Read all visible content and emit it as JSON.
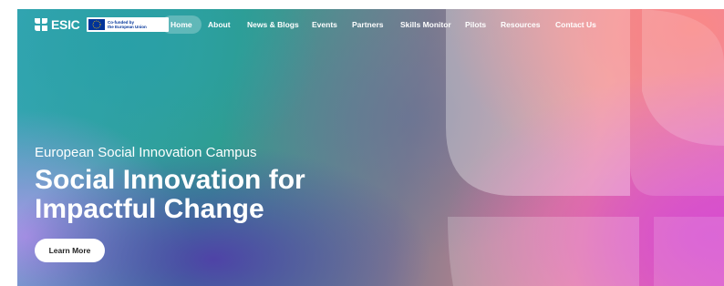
{
  "brand": {
    "logo_text": "ESIC",
    "eu_badge_text": "Co-funded by\nthe European Union"
  },
  "nav": {
    "items": [
      {
        "label": "Home",
        "active": true
      },
      {
        "label": "About"
      },
      {
        "label": "News & Blogs"
      },
      {
        "label": "Events"
      },
      {
        "label": "Partners"
      },
      {
        "label": "Skills Monitor"
      },
      {
        "label": "Pilots"
      },
      {
        "label": "Resources"
      },
      {
        "label": "Contact Us"
      }
    ]
  },
  "hero": {
    "subtitle": "European Social Innovation Campus",
    "headline_line1": "Social Innovation for",
    "headline_line2": "Impactful Change",
    "cta_label": "Learn More"
  },
  "colors": {
    "text": "#ffffff",
    "button_bg": "#ffffff",
    "button_text": "#222222",
    "teal": "#2f9d8f",
    "coral": "#f86e6c",
    "magenta": "#d64ed0"
  }
}
